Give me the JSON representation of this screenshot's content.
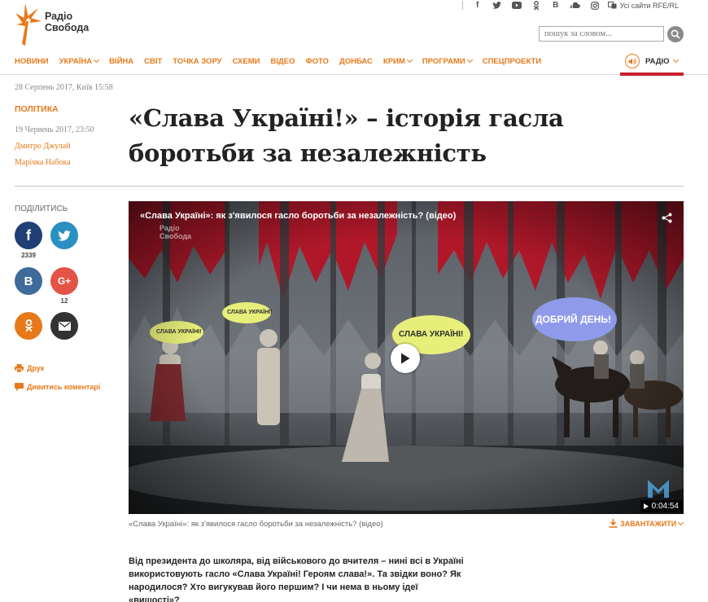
{
  "brand": {
    "line1": "Радіо",
    "line2": "Свобода",
    "accent": "#e8791a"
  },
  "social": {
    "icons": [
      "facebook-icon",
      "twitter-icon",
      "youtube-icon",
      "odnoklassniki-icon",
      "vkontakte-icon",
      "soundcloud-icon",
      "instagram-icon"
    ],
    "sites_label": "Усі сайти RFE/RL"
  },
  "search": {
    "placeholder": "пошук за словом..."
  },
  "nav": {
    "items": [
      {
        "label": "НОВИНИ",
        "chevron": false
      },
      {
        "label": "УКРАЇНА",
        "chevron": true
      },
      {
        "label": "ВІЙНА",
        "chevron": false
      },
      {
        "label": "СВІТ",
        "chevron": false
      },
      {
        "label": "ТОЧКА ЗОРУ",
        "chevron": false
      },
      {
        "label": "СХЕМИ",
        "chevron": false
      },
      {
        "label": "ВІДЕО",
        "chevron": false
      },
      {
        "label": "ФОТО",
        "chevron": false
      },
      {
        "label": "ДОНБАС",
        "chevron": false
      },
      {
        "label": "КРИМ",
        "chevron": true
      },
      {
        "label": "ПРОГРАМИ",
        "chevron": true
      },
      {
        "label": "СПЕЦПРОЕКТИ",
        "chevron": false
      }
    ],
    "radio_label": "РАДІО",
    "active_color": "#c8202d"
  },
  "meta": {
    "current_date": "28 Серпень 2017, Київ 15:58",
    "section": "ПОЛІТИКА",
    "published": "19 Червень 2017, 23:50",
    "authors": [
      "Дмитро Джулай",
      "Марічка Набока"
    ]
  },
  "article": {
    "title": "«Слава Україні!» – історія гасла боротьби за незалежність",
    "lead": "Від президента до школяра, від військового до вчителя – нині всі в Україні використовують гасло «Слава Україні! Героям слава!». Та звідки воно? Як народилося? Хто вигукував його першим? І чи нема в ньому ідеї «вищості»?"
  },
  "share": {
    "label": "ПОДІЛИТИСЬ",
    "facebook_count": "2339",
    "gplus_count": "12",
    "print_label": "Друк",
    "comments_label": "Дивитись коментарі"
  },
  "video": {
    "title": "«Слава Україні»: як з'явилося гасло боротьби за незалежність? (відео)",
    "duration": "0:04:54",
    "caption": "«Слава Україні»: як з'явилося гасло боротьби за незалежність? (відео)",
    "download_label": "ЗАВАНТАЖИТИ",
    "bubbles": [
      "СЛАВА УКРАЇНІ!",
      "СЛАВА УКРАЇНІ!",
      "СЛАВА УКРАЇНІ!",
      "ДОБРИЙ ДЕНЬ!"
    ],
    "watermark": "Радіо Свобода"
  }
}
